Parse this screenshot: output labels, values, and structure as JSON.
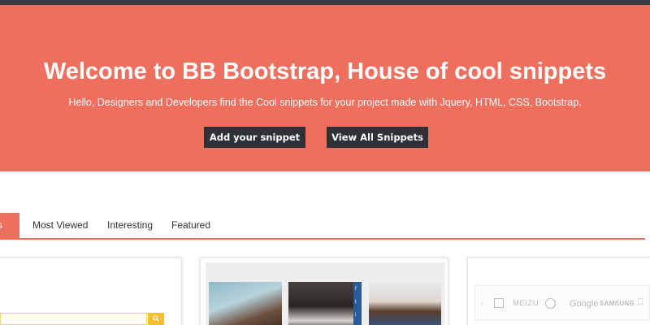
{
  "hero": {
    "title": "Welcome to BB Bootstrap, House of cool snippets",
    "subtitle": "Hello, Designers and Developers find the Cool snippets for your project made with Jquery, HTML, CSS, Bootstrap.",
    "add_button": "Add your snippet",
    "view_button": "View All Snippets",
    "background_color": "#ef6f5f"
  },
  "tabs": [
    {
      "label": "ets",
      "active": true
    },
    {
      "label": "Most Viewed",
      "active": false
    },
    {
      "label": "Interesting",
      "active": false
    },
    {
      "label": "Featured",
      "active": false
    }
  ],
  "cards": {
    "search": {
      "placeholder": "",
      "button_icon": "search-icon"
    },
    "gallery": {
      "social_icons": [
        "f",
        "t",
        "i"
      ]
    },
    "logos": {
      "prev_icon": "‹",
      "items": [
        "MEIZU",
        "Google",
        "SAMSUNG"
      ]
    }
  },
  "colors": {
    "accent": "#ef6f5f",
    "button_dark": "#2e3137",
    "search_button": "#f5c033",
    "top_bar": "#3a3b3e"
  }
}
